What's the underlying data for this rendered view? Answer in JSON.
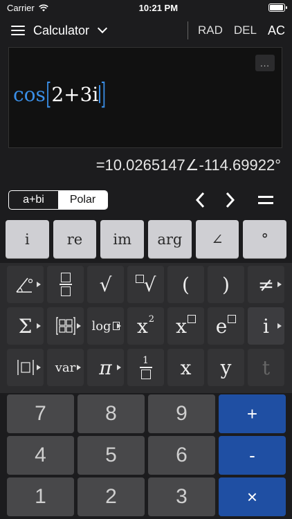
{
  "status": {
    "carrier": "Carrier",
    "time": "10:21 PM"
  },
  "topbar": {
    "title": "Calculator",
    "rad": "RAD",
    "del": "DEL",
    "ac": "AC"
  },
  "display": {
    "more": "...",
    "fn": "cos",
    "arg": "2+3i"
  },
  "result": "=10.0265147∠-114.69922°",
  "modes": {
    "rect": "a+bi",
    "polar": "Polar"
  },
  "nav": {
    "left": "<",
    "right": ">",
    "equals": "="
  },
  "complex_keys": [
    "i",
    "re",
    "im",
    "arg",
    "∠",
    "°"
  ],
  "func_keys": {
    "sqrt": "√",
    "lparen": "(",
    "rparen": ")",
    "neq": "≠",
    "sigma": "Σ",
    "log": "log",
    "x": "x",
    "e": "e",
    "i": "i",
    "var": "var",
    "pi": "π",
    "one": "1",
    "xvar": "x",
    "yvar": "y",
    "tvar": "t",
    "two": "2"
  },
  "numpad": [
    "7",
    "8",
    "9",
    "+",
    "4",
    "5",
    "6",
    "-",
    "1",
    "2",
    "3",
    "×"
  ]
}
